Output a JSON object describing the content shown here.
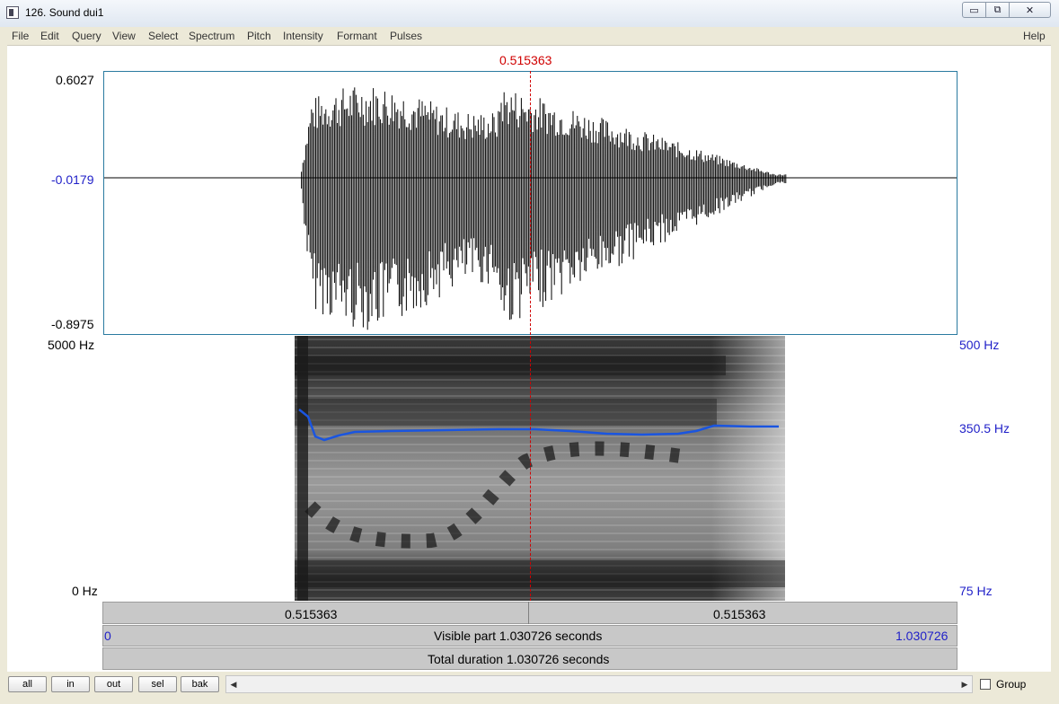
{
  "window": {
    "title": "126. Sound dui1",
    "icon": "praat-document-icon",
    "controls": {
      "minimize": "▭",
      "maximize": "⧉",
      "close": "✕"
    }
  },
  "menu": {
    "items": [
      "File",
      "Edit",
      "Query",
      "View",
      "Select",
      "Spectrum",
      "Pitch",
      "Intensity",
      "Formant",
      "Pulses"
    ],
    "help": "Help"
  },
  "cursor": {
    "time_label": "0.515363",
    "color": "#d00000"
  },
  "waveform": {
    "max_label": "0.6027",
    "mid_label": "-0.0179",
    "min_label": "-0.8975"
  },
  "spectrogram": {
    "freq_top_label": "5000 Hz",
    "freq_bottom_label": "0 Hz",
    "pitch_top_label": "500 Hz",
    "pitch_mid_label": "350.5 Hz",
    "pitch_bottom_label": "75 Hz",
    "pitch_color": "#1a55e0"
  },
  "time_bar": {
    "left_label": "0.515363",
    "right_label": "0.515363"
  },
  "visible_bar": {
    "start": "0",
    "text": "Visible part 1.030726 seconds",
    "end": "1.030726"
  },
  "total_bar": {
    "text": "Total duration 1.030726 seconds"
  },
  "toolbar": {
    "buttons": [
      "all",
      "in",
      "out",
      "sel",
      "bak"
    ],
    "scroll_left": "◀",
    "scroll_right": "▶",
    "group_label": "Group"
  }
}
